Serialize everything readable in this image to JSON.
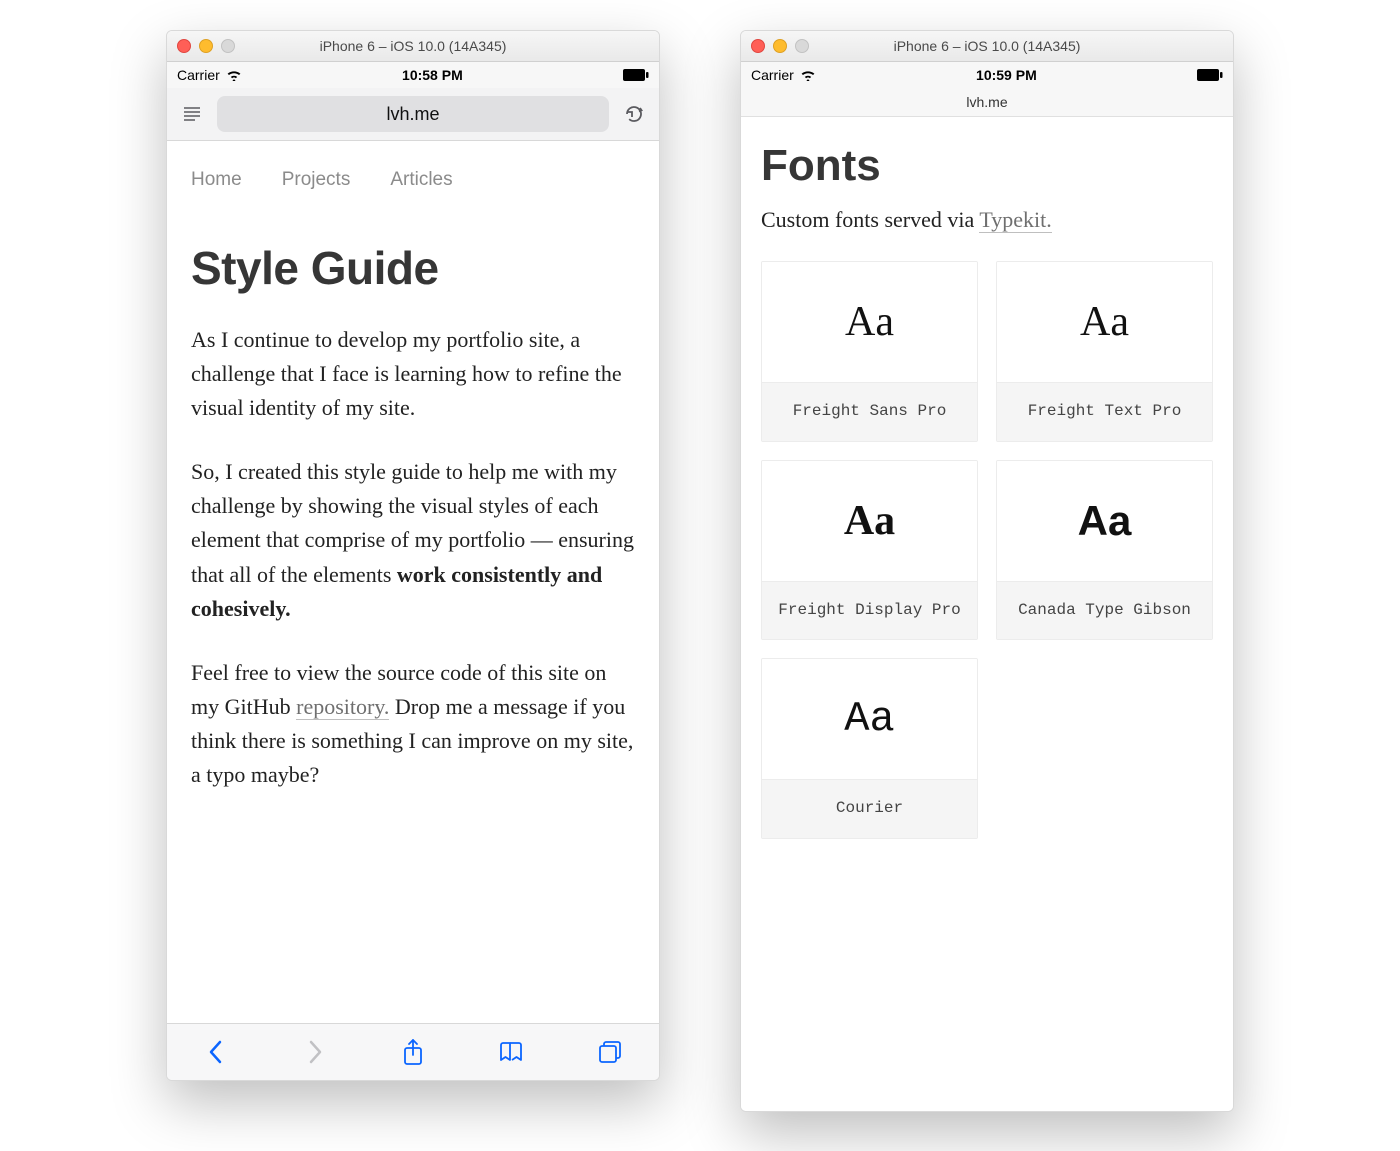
{
  "left": {
    "window_title": "iPhone 6 – iOS 10.0 (14A345)",
    "status": {
      "carrier": "Carrier",
      "time": "10:58 PM"
    },
    "url": "lvh.me",
    "nav": {
      "home": "Home",
      "projects": "Projects",
      "articles": "Articles"
    },
    "heading": "Style Guide",
    "p1": "As I continue to develop my portfolio site, a challenge that I face is learning how to refine the visual identity of my site.",
    "p2_a": "So, I created this style guide to help me with my challenge by showing the visual styles of each element that comprise of my portfolio — ensuring that all of the elements ",
    "p2_strong": "work consistently and cohesively.",
    "p3_a": "Feel free to view the source code of this site on my GitHub ",
    "p3_link": "repository.",
    "p3_b": " Drop me a message if you think there is something I can improve on my site, a typo maybe?"
  },
  "right": {
    "window_title": "iPhone 6 – iOS 10.0 (14A345)",
    "status": {
      "carrier": "Carrier",
      "time": "10:59 PM"
    },
    "url": "lvh.me",
    "heading": "Fonts",
    "lede_a": "Custom fonts served via ",
    "lede_link": "Typekit.",
    "cards": [
      {
        "sample": "Aa",
        "label": "Freight Sans Pro",
        "cls": "serif"
      },
      {
        "sample": "Aa",
        "label": "Freight Text Pro",
        "cls": "serif"
      },
      {
        "sample": "Aa",
        "label": "Freight Display Pro",
        "cls": "serif-display"
      },
      {
        "sample": "Aa",
        "label": "Canada Type Gibson",
        "cls": "sans-bold"
      },
      {
        "sample": "Aa",
        "label": "Courier",
        "cls": "mono"
      }
    ]
  }
}
